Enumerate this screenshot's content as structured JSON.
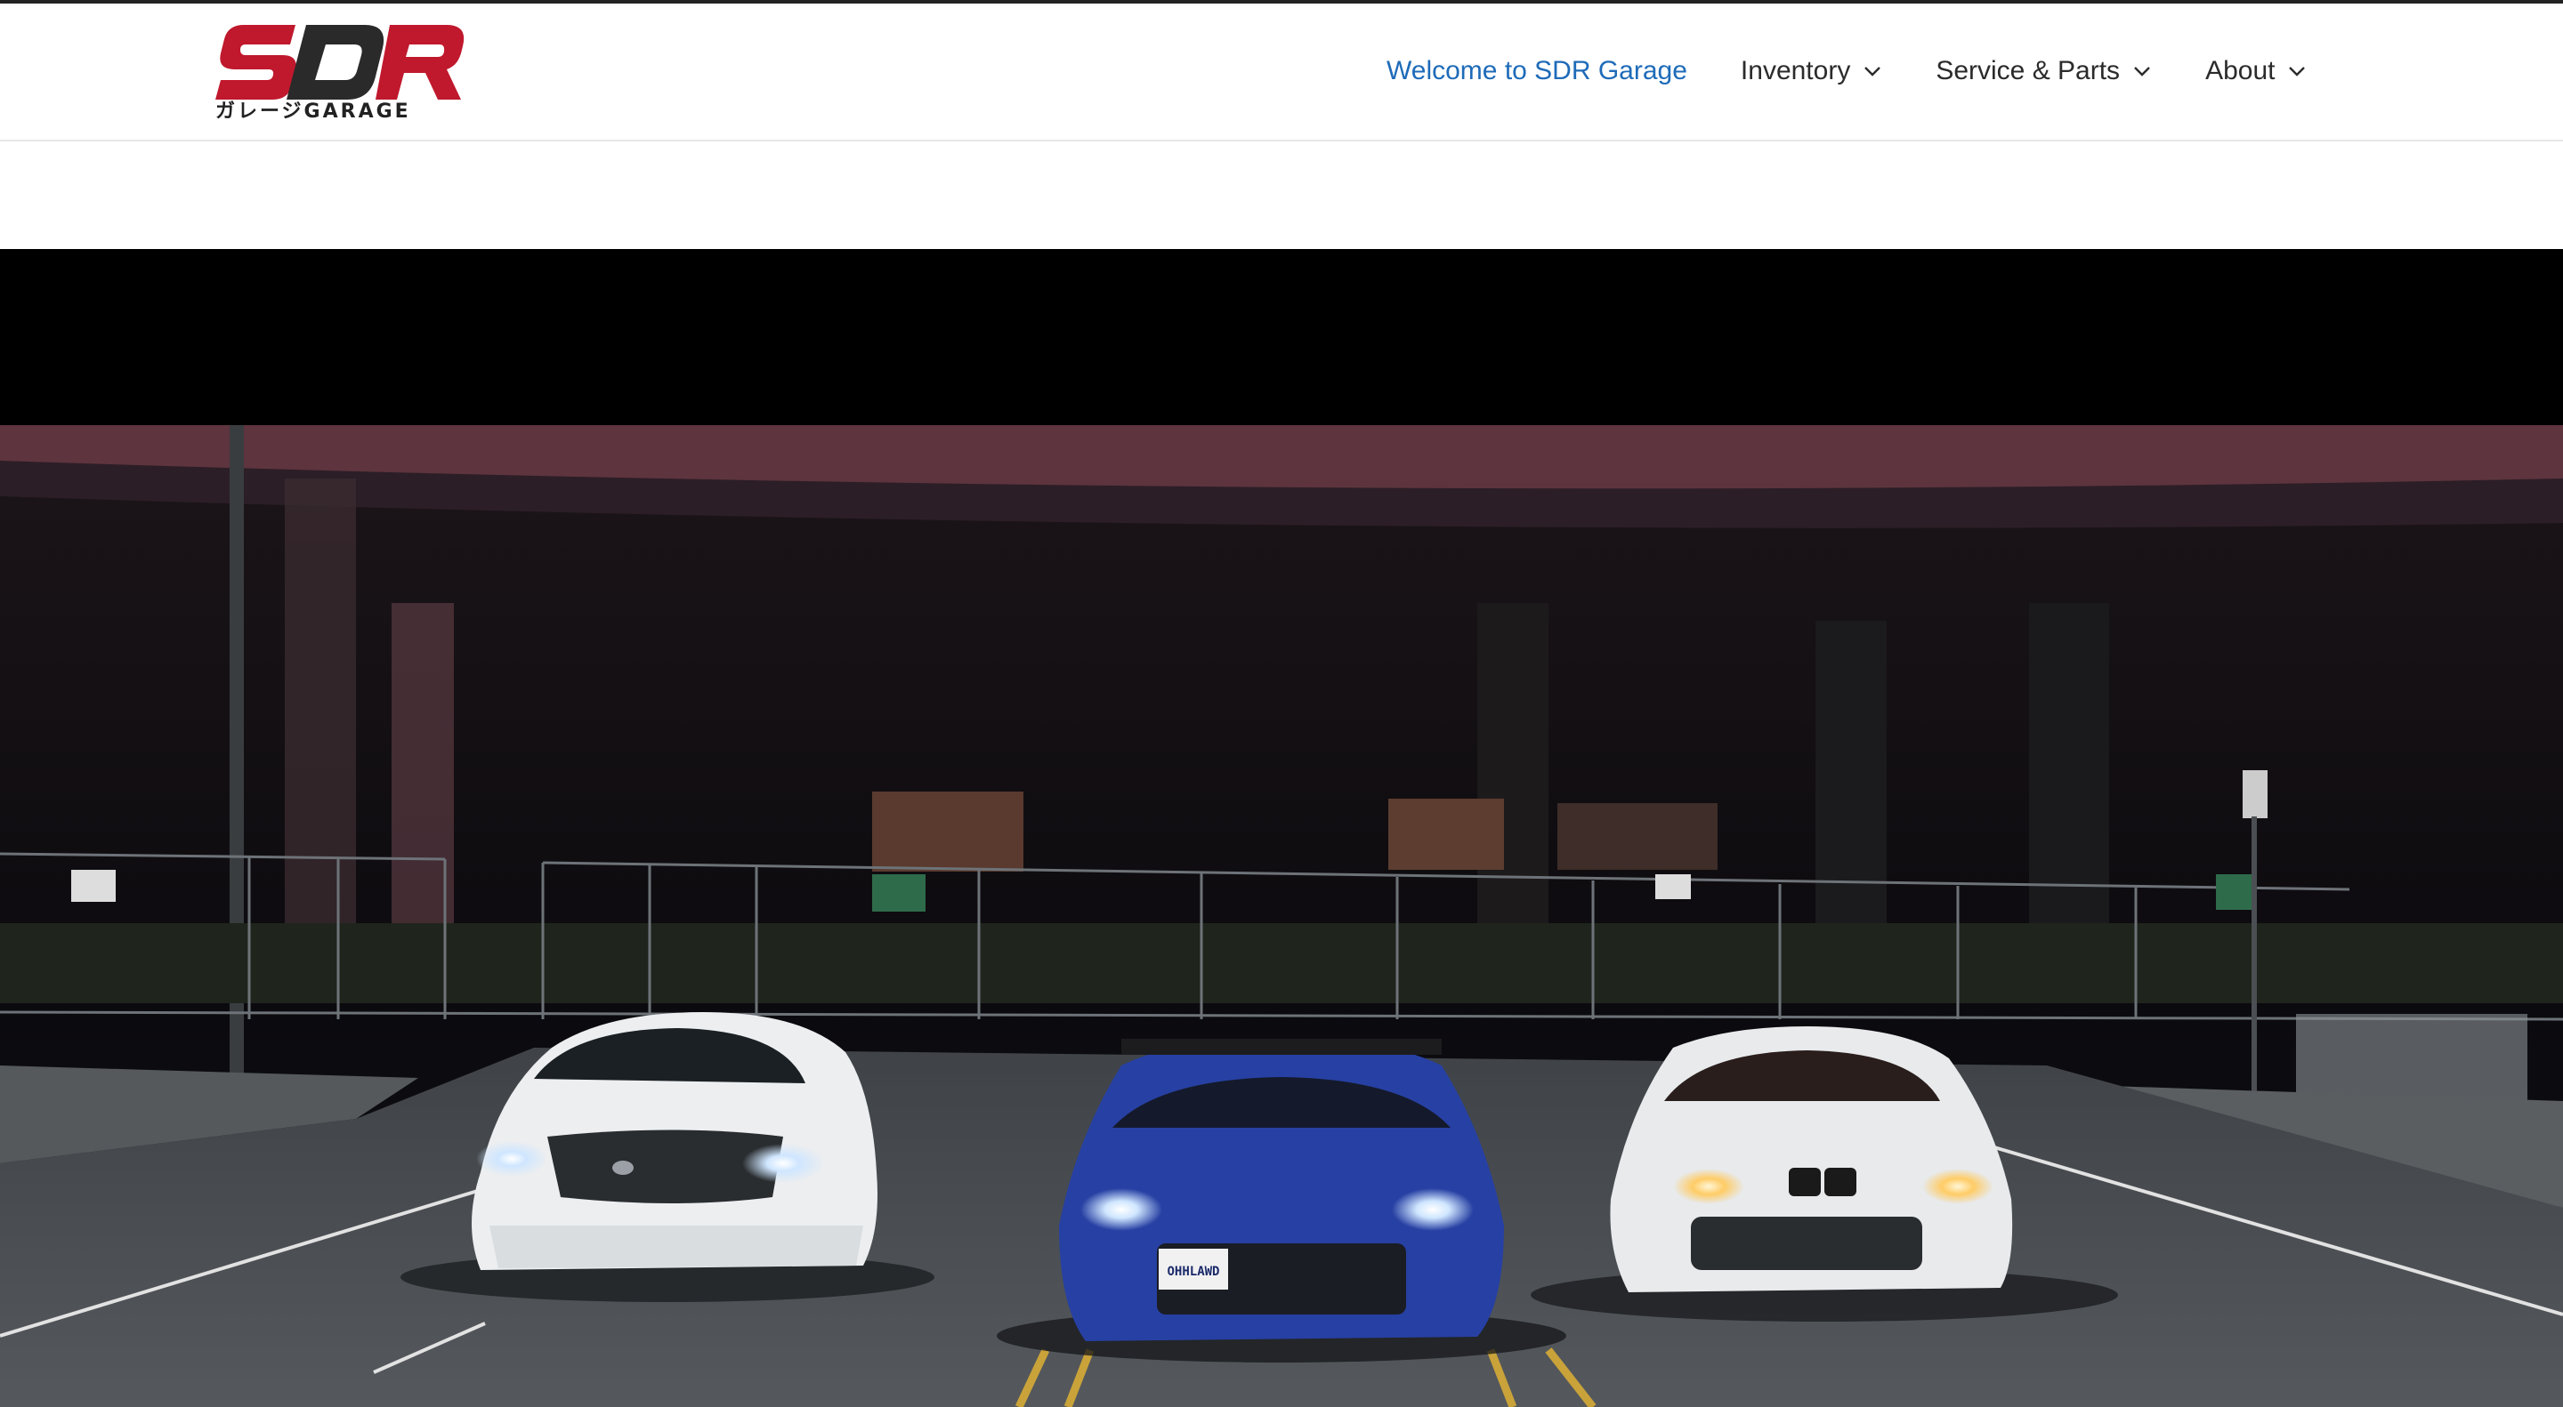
{
  "brand": {
    "logo_text": "SDR",
    "logo_subtext": "ガレージGARAGE",
    "colors": {
      "red": "#c0182d",
      "dark": "#2a2a2a"
    }
  },
  "nav": {
    "items": [
      {
        "label": "Welcome to SDR Garage",
        "active": true,
        "has_dropdown": false
      },
      {
        "label": "Inventory",
        "active": false,
        "has_dropdown": true
      },
      {
        "label": "Service & Parts",
        "active": false,
        "has_dropdown": true
      },
      {
        "label": "About",
        "active": false,
        "has_dropdown": true
      }
    ],
    "active_color": "#1e6bb8",
    "icon": "chevron-down-icon"
  },
  "hero": {
    "plate_text": "OHHLAWD"
  }
}
